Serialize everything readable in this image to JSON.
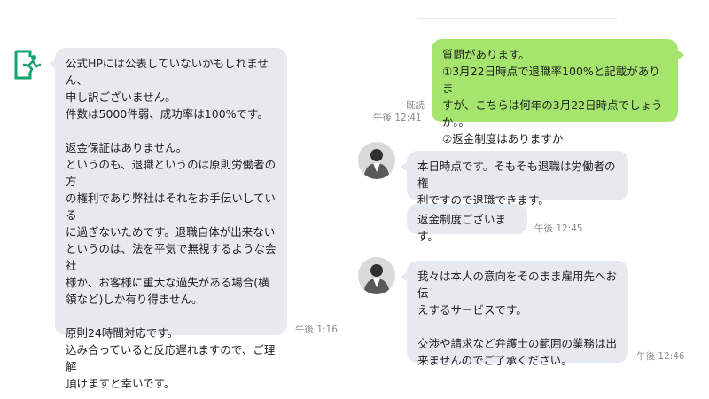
{
  "left_chat": {
    "icon": "exit-door-icon",
    "message": "公式HPには公表していないかもしれません、\n申し訳ございません。\n件数は5000件弱、成功率は100%です。\n\n返金保証はありません。\nというのも、退職というのは原則労働者の方\nの権利であり弊社はそれをお手伝いしている\nに過ぎないためです。退職自体が出来ない\nというのは、法を平気で無視するような会社\n様か、お客様に重大な過失がある場合(横\n領など)しか有り得ません。\n\n原則24時間対応です。\n込み合っていると反応遅れますので、ご理解\n頂けますと幸いです。",
    "time": "午後 1:16"
  },
  "right_chat": {
    "sent_message": "質問があります。\n①3月22日時点で退職率100%と記載がありま\nすが、こちらは何年の3月22日時点でしょうか。。\n②返金制度はありますか",
    "read_label": "既読",
    "sent_time": "午後 12:41",
    "reply1": "本日時点です。そもそも退職は労働者の権\n利ですので退職できます。",
    "reply2": "返金制度ございます。",
    "reply_time": "午後 12:45",
    "reply3": "我々は本人の意向をそのまま雇用先へお伝\nえするサービスです。\n\n交渉や請求など弁護士の範囲の業務は出\n来ませんのでご了承ください。",
    "reply3_time": "午後 12:46"
  },
  "colors": {
    "gray_bubble": "#e6e9ee",
    "green_bubble": "#a6e56d",
    "icon_green": "#13a36b"
  }
}
